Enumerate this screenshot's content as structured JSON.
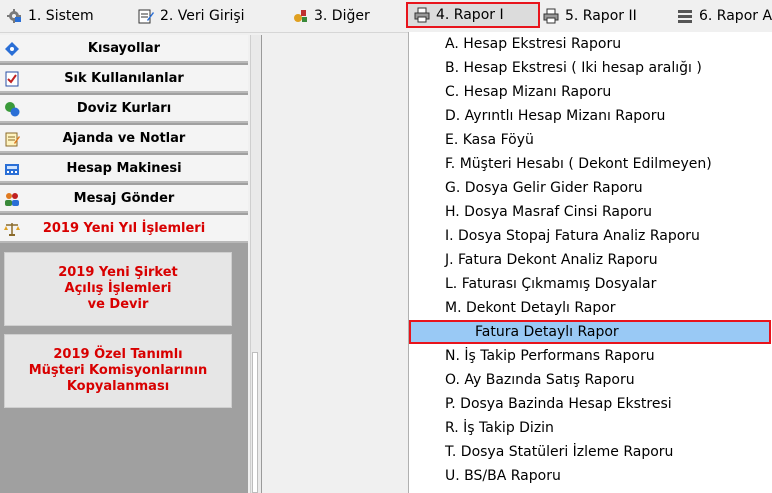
{
  "menubar": {
    "items": [
      {
        "label": "1.  Sistem",
        "icon": "gear-icon"
      },
      {
        "label": "2.  Veri Girişi",
        "icon": "edit-icon"
      },
      {
        "label": "3.  Diğer",
        "icon": "tools-icon"
      },
      {
        "label": "4.  Rapor I",
        "icon": "printer-icon",
        "active": true
      },
      {
        "label": "5.  Rapor II",
        "icon": "printer-icon"
      },
      {
        "label": "6.  Rapor A",
        "icon": "list-icon"
      }
    ]
  },
  "sidebar": {
    "items": [
      {
        "label": "Kısayollar",
        "icon": "diamond-icon"
      },
      {
        "label": "Sık Kullanılanlar",
        "icon": "checklist-icon"
      },
      {
        "label": "Doviz Kurları",
        "icon": "globe-icon"
      },
      {
        "label": "Ajanda ve Notlar",
        "icon": "notepad-icon"
      },
      {
        "label": "Hesap Makinesi",
        "icon": "calculator-icon"
      },
      {
        "label": "Mesaj Gönder",
        "icon": "users-icon"
      },
      {
        "label": "2019 Yeni Yıl İşlemleri",
        "icon": "scales-icon",
        "highlight": true
      }
    ],
    "big_buttons": [
      {
        "lines": [
          "2019 Yeni Şirket",
          "Açılış İşlemleri",
          "ve Devir"
        ]
      },
      {
        "lines": [
          "2019 Özel Tanımlı",
          "Müşteri Komisyonlarının",
          "Kopyalanması"
        ]
      }
    ]
  },
  "dropdown": {
    "items": [
      "A.  Hesap Ekstresi Raporu",
      "B.  Hesap Ekstresi ( Iki hesap aralığı )",
      "C.  Hesap Mizanı Raporu",
      "D.  Ayrıntlı Hesap Mizanı Raporu",
      "E.  Kasa Föyü",
      "F.  Müşteri Hesabı ( Dekont Edilmeyen)",
      "G.  Dosya Gelir Gider Raporu",
      "H.  Dosya Masraf Cinsi Raporu",
      "I.  Dosya Stopaj Fatura Analiz Raporu",
      "J.  Fatura Dekont Analiz Raporu",
      "L.  Faturası Çıkmamış Dosyalar",
      "M.  Dekont Detaylı Rapor"
    ],
    "selected": "Fatura Detaylı Rapor",
    "items_after": [
      "N.  İş Takip Performans Raporu",
      "O.  Ay Bazında Satış Raporu",
      "P.  Dosya Bazinda Hesap Ekstresi",
      "R.  İş Takip Dizin",
      "T.  Dosya Statüleri İzleme Raporu",
      "U.  BS/BA Raporu"
    ]
  },
  "colors": {
    "highlight_border": "#e8141c",
    "selected_bg": "#99c9f5",
    "red_text": "#d80000"
  }
}
